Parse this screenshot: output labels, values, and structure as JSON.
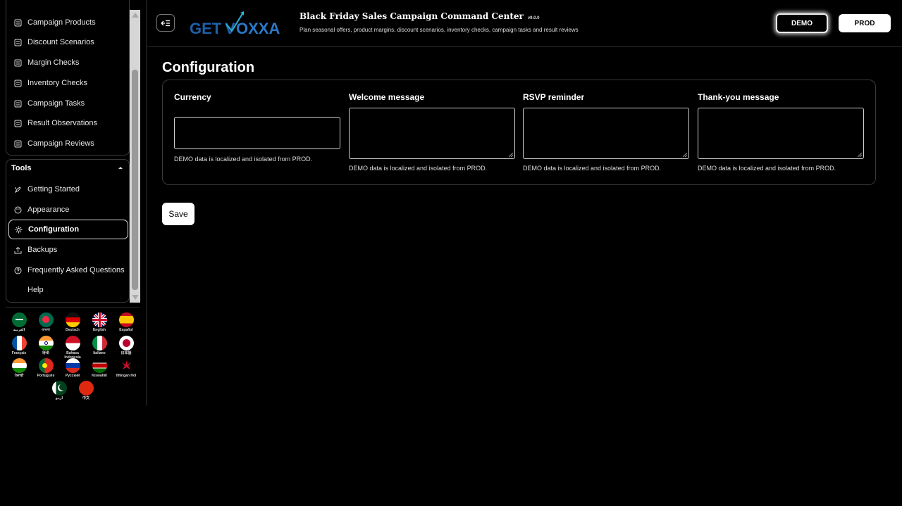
{
  "sidebar": {
    "items": [
      {
        "label": "Campaign Products",
        "icon": "list-icon"
      },
      {
        "label": "Discount Scenarios",
        "icon": "list-icon"
      },
      {
        "label": "Margin Checks",
        "icon": "list-icon"
      },
      {
        "label": "Inventory Checks",
        "icon": "list-icon"
      },
      {
        "label": "Campaign Tasks",
        "icon": "list-icon"
      },
      {
        "label": "Result Observations",
        "icon": "list-icon"
      },
      {
        "label": "Campaign Reviews",
        "icon": "list-icon"
      }
    ],
    "tools": {
      "title": "Tools",
      "items": [
        {
          "label": "Getting Started",
          "icon": "rocket-icon"
        },
        {
          "label": "Appearance",
          "icon": "palette-icon"
        },
        {
          "label": "Configuration",
          "icon": "gear-icon",
          "active": true
        },
        {
          "label": "Backups",
          "icon": "upload-icon"
        },
        {
          "label": "Frequently Asked Questions",
          "icon": "question-icon"
        },
        {
          "label": "Help",
          "icon": ""
        }
      ]
    },
    "languages": [
      "العربية",
      "বাংলা",
      "Deutsch",
      "English",
      "Español",
      "Français",
      "हिन्दी",
      "Bahasa Indonesia",
      "Italiano",
      "日本語",
      "ਪੰਜਾਬੀ",
      "Português",
      "Русский",
      "Kiswahili",
      "tlhIngan Hol",
      "اردو",
      "中文"
    ]
  },
  "header": {
    "logo_text": "GETVOXXA",
    "title": "Black Friday Sales Campaign Command Center",
    "version": "v9.0.0",
    "subtitle": "Plan seasonal offers, product margins, discount scenarios, inventory checks, campaign tasks and result reviews",
    "demo_label": "DEMO",
    "prod_label": "PROD"
  },
  "main": {
    "title": "Configuration",
    "fields": [
      {
        "label": "Currency",
        "value": "",
        "help": "DEMO data is localized and isolated from PROD."
      },
      {
        "label": "Welcome message",
        "value": "",
        "help": "DEMO data is localized and isolated from PROD."
      },
      {
        "label": "RSVP reminder",
        "value": "",
        "help": "DEMO data is localized and isolated from PROD."
      },
      {
        "label": "Thank-you message",
        "value": "",
        "help": "DEMO data is localized and isolated from PROD."
      }
    ],
    "save_label": "Save"
  }
}
